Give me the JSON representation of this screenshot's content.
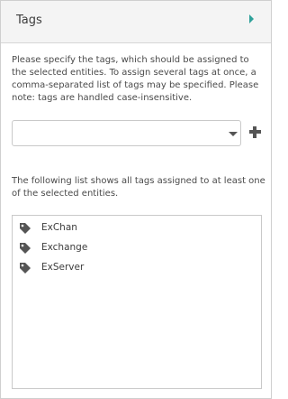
{
  "panel": {
    "title": "Tags",
    "collapse_icon": "caret-right-icon",
    "accent_color": "#2fa19a"
  },
  "description": "Please specify the tags, which should be assigned to the selected entities. To assign several tags at once, a comma-separated list of tags may be specified. Please note: tags are handled case-insensitive.",
  "tag_input": {
    "value": "",
    "placeholder": "",
    "dropdown_icon": "chevron-down-icon",
    "add_icon": "plus-icon"
  },
  "list_caption": "The following list shows all tags assigned to at least one of the selected entities.",
  "tags": [
    {
      "label": "ExChan",
      "icon": "tag-icon"
    },
    {
      "label": "Exchange",
      "icon": "tag-icon"
    },
    {
      "label": "ExServer",
      "icon": "tag-icon"
    }
  ]
}
